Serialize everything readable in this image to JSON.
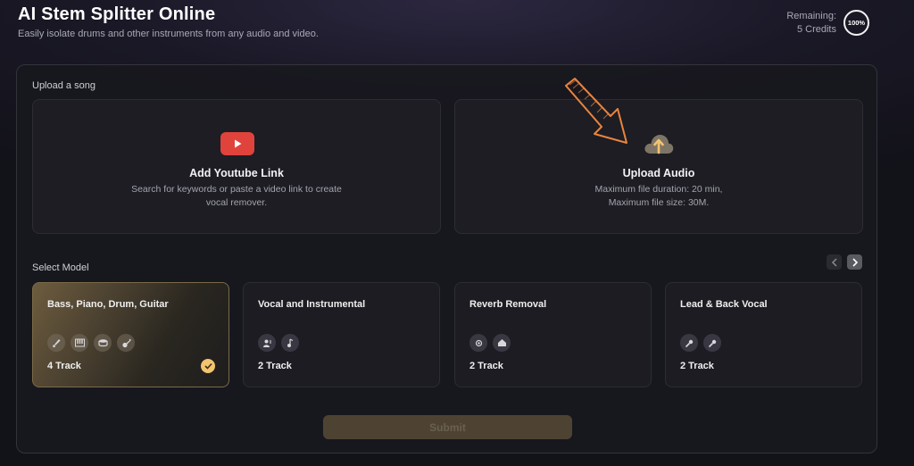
{
  "header": {
    "title": "AI Stem Splitter Online",
    "subtitle": "Easily isolate drums and other instruments from any audio and video.",
    "remaining_label": "Remaining:",
    "credits_text": "5 Credits",
    "credit_percent": "100%"
  },
  "upload": {
    "section_label": "Upload a song",
    "youtube": {
      "title": "Add Youtube Link",
      "desc": "Search for keywords or paste a video link to create vocal remover.",
      "icon": "youtube-icon"
    },
    "audio": {
      "title": "Upload Audio",
      "desc_line1": "Maximum file duration: 20 min,",
      "desc_line2": "Maximum file size: 30M.",
      "icon": "cloud-upload-icon"
    }
  },
  "models": {
    "section_label": "Select Model",
    "items": [
      {
        "name": "Bass, Piano, Drum, Guitar",
        "tracks": "4 Track",
        "selected": true,
        "icons": [
          "bass-icon",
          "piano-icon",
          "drum-icon",
          "guitar-icon"
        ]
      },
      {
        "name": "Vocal and Instrumental",
        "tracks": "2 Track",
        "selected": false,
        "icons": [
          "vocal-icon",
          "instrument-icon"
        ]
      },
      {
        "name": "Reverb Removal",
        "tracks": "2 Track",
        "selected": false,
        "icons": [
          "reverb-icon",
          "dry-icon"
        ]
      },
      {
        "name": "Lead & Back Vocal",
        "tracks": "2 Track",
        "selected": false,
        "icons": [
          "lead-mic-icon",
          "back-mic-icon"
        ]
      }
    ]
  },
  "submit_label": "Submit",
  "colors": {
    "accent": "#f3c46e",
    "youtube_red": "#e0433b",
    "submit_bg": "#4e4332"
  }
}
